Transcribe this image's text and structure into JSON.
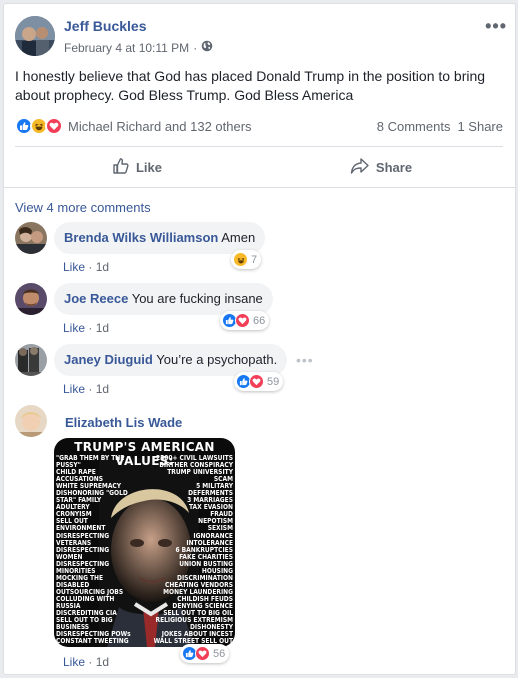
{
  "post": {
    "author": "Jeff Buckles",
    "timestamp": "February 4 at 10:11 PM",
    "privacy_icon": "globe-icon",
    "text": "I honestly believe that God has placed Donald Trump in the position to bring about prophecy. God Bless Trump. God Bless America",
    "reaction_names": "Michael Richard and 132 others",
    "comments_count": "8 Comments",
    "shares_count": "1 Share"
  },
  "actions": {
    "like": "Like",
    "share": "Share"
  },
  "view_more": "View 4 more comments",
  "comments": [
    {
      "name": "Brenda Wilks Williamson",
      "text": "Amen",
      "like": "Like",
      "time": "1d",
      "reaction_count": "7"
    },
    {
      "name": "Joe Reece",
      "text": "You are fucking insane",
      "like": "Like",
      "time": "1d",
      "reaction_count": "66"
    },
    {
      "name": "Janey Diuguid",
      "text": "You’re a psychopath.",
      "like": "Like",
      "time": "1d",
      "reaction_count": "59"
    },
    {
      "name": "Elizabeth Lis Wade",
      "like": "Like",
      "time": "1d",
      "reaction_count": "56"
    }
  ],
  "meme": {
    "title": "TRUMP'S AMERICAN VALUES:",
    "left": [
      "\"GRAB THEM BY THE",
      "PUSSY\"",
      "CHILD RAPE",
      "ACCUSATIONS",
      "WHITE SUPREMACY",
      "DISHONORING \"GOLD",
      "STAR\" FAMILY",
      "ADULTERY",
      "CRONYISM",
      "SELL OUT",
      "ENVIRONMENT",
      "DISRESPECTING",
      "VETERANS",
      "DISRESPECTING",
      "WOMEN",
      "DISRESPECTING",
      "MINORITIES",
      "MOCKING THE",
      "DISABLED",
      "OUTSOURCING JOBS",
      "COLLUDING WITH",
      "RUSSIA",
      "DISCREDITING CIA",
      "SELL OUT TO BIG",
      "BUSINESS",
      "DISRESPECTING POWs",
      "CONSTANT TWEETING"
    ],
    "right": [
      "2500+ CIVIL LAWSUITS",
      "BIRTHER CONSPIRACY",
      "TRUMP UNIVERSITY",
      "SCAM",
      "5 MILITARY",
      "DEFERMENTS",
      "3 MARRIAGES",
      "TAX EVASION",
      "FRAUD",
      "NEPOTISM",
      "SEXISM",
      "IGNORANCE",
      "INTOLERANCE",
      "6 BANKRUPTCIES",
      "FAKE CHARITIES",
      "UNION BUSTING",
      "HOUSING",
      "DISCRIMINATION",
      "CHEATING VENDORS",
      "MONEY LAUNDERING",
      "CHILDISH FEUDS",
      "DENYING SCIENCE",
      "SELL OUT TO BIG OIL",
      "RELIGIOUS EXTREMISM",
      "DISHONESTY",
      "JOKES ABOUT INCEST",
      "WALL STREET SELL OUT"
    ]
  },
  "colors": {
    "link": "#385898",
    "like_blue": "#1877f2",
    "love_red": "#f33e58",
    "haha_yellow": "#f7b928"
  }
}
